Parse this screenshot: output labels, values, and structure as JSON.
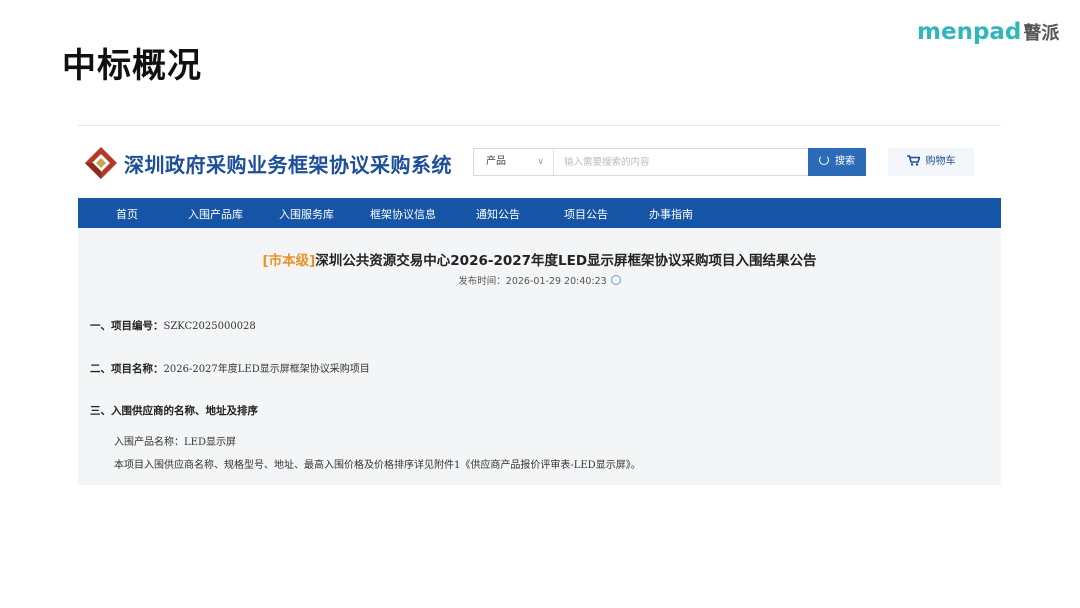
{
  "slide": {
    "title": "中标概况",
    "brand_latin": "menpad",
    "brand_cjk": "瞽派"
  },
  "site": {
    "name": "深圳政府采购业务框架协议采购系统",
    "search": {
      "category": "产品",
      "placeholder": "输入需要搜索的内容",
      "button": "搜索"
    },
    "cart": "购物车",
    "nav": [
      "首页",
      "入围产品库",
      "入围服务库",
      "框架协议信息",
      "通知公告",
      "项目公告",
      "办事指南"
    ]
  },
  "notice": {
    "tag": "[市本级]",
    "title": "深圳公共资源交易中心2026-2027年度LED显示屏框架协议采购项目入围结果公告",
    "published_label": "发布时间：",
    "published": "2026-01-29 20:40:23",
    "project_no_label": "一、项目编号：",
    "project_no": "SZKC2025000028",
    "project_name_label": "二、项目名称：",
    "project_name": "2026-2027年度LED显示屏框架协议采购项目",
    "section3": "三、入围供应商的名称、地址及排序",
    "product_line": "入围产品名称：LED显示屏",
    "detail_line": "本项目入围供应商名称、规格型号、地址、最高入围价格及价格排序详见附件1《供应商产品报价评审表-LED显示屏》。"
  },
  "colors": {
    "brand_teal": "#31b7ba",
    "site_blue": "#1d4f99",
    "nav_blue": "#1655a6",
    "tag_orange": "#e8932e"
  }
}
